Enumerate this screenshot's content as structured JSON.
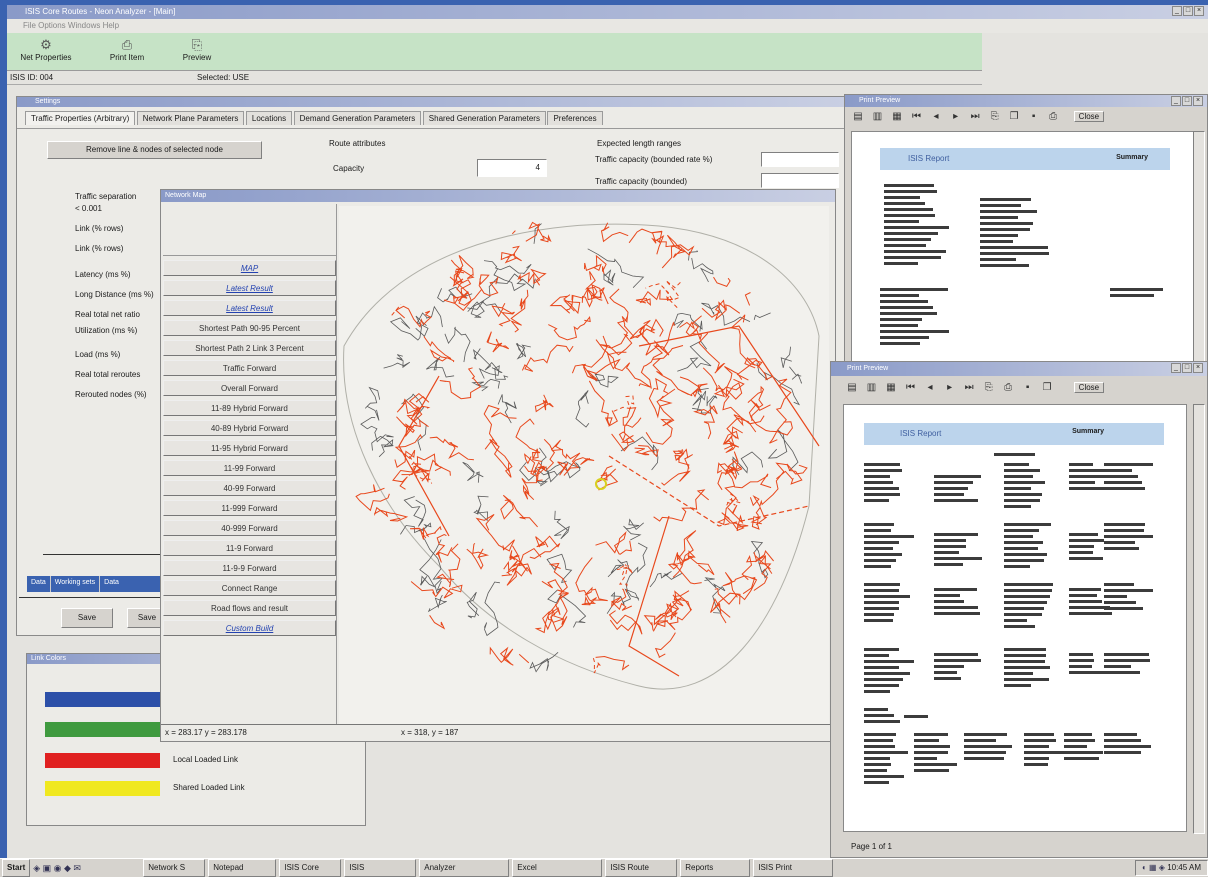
{
  "app": {
    "title": "ISIS Core Routes - Neon Analyzer - [Main]",
    "menu": "File   Options   Windows   Help",
    "toolbar": [
      {
        "label": "Net Properties",
        "icon": "gear-icon"
      },
      {
        "label": "Print Item",
        "icon": "printer-icon"
      },
      {
        "label": "Preview",
        "icon": "preview-icon"
      }
    ],
    "status_left": "ISIS ID: 004",
    "status_mid": "Selected:   USE"
  },
  "main_window": {
    "title": "Settings",
    "tabs": [
      "Traffic Properties (Arbitrary)",
      "Network Plane Parameters",
      "Locations",
      "Demand Generation Parameters",
      "Shared Generation Parameters",
      "Preferences"
    ],
    "options_button": "Remove line & nodes of selected node",
    "route_group_label": "Route attributes",
    "route_field_label": "Capacity",
    "route_field_value": "4",
    "fields_header": "Expected length ranges",
    "field1_label": "Traffic capacity (bounded rate %)",
    "field2_label": "Traffic capacity (bounded)",
    "left_labels": [
      "Traffic separation",
      "< 0.001",
      "Link (% rows)",
      "Link (% rows)",
      "Latency (ms %)",
      "Long Distance (ms %)",
      "Real total net ratio",
      "Utilization (ms %)",
      "Load (ms %)",
      "Real total reroutes",
      "Rerouted nodes (%)"
    ],
    "bottom_tabs": [
      "Data",
      "Working sets",
      "Data"
    ],
    "save_button": "Save",
    "cancel_button": "Save"
  },
  "map_window": {
    "title": "Network Map",
    "legend_items": [
      {
        "label": "MAP",
        "link": true
      },
      {
        "label": "Latest Result",
        "link": true
      },
      {
        "label": "Latest Result",
        "link": true
      },
      {
        "label": "Shortest Path 90-95 Percent",
        "link": false
      },
      {
        "label": "Shortest Path 2 Link 3 Percent",
        "link": false
      },
      {
        "label": "Traffic Forward",
        "link": false
      },
      {
        "label": "Overall Forward",
        "link": false
      },
      {
        "label": "11-89 Hybrid Forward",
        "link": false
      },
      {
        "label": "40-89 Hybrid Forward",
        "link": false
      },
      {
        "label": "11-95 Hybrid Forward",
        "link": false
      },
      {
        "label": "11-99 Forward",
        "link": false
      },
      {
        "label": "40-99 Forward",
        "link": false
      },
      {
        "label": "11-999 Forward",
        "link": false
      },
      {
        "label": "40-999 Forward",
        "link": false
      },
      {
        "label": "11-9 Forward",
        "link": false
      },
      {
        "label": "11-9-9 Forward",
        "link": false
      },
      {
        "label": "Connect Range",
        "link": false
      },
      {
        "label": "Road flows and result",
        "link": false
      },
      {
        "label": "Custom Build",
        "link": true
      }
    ],
    "coord_left": "x = 283.17   y = 283.178",
    "coord_right": "x = 318, y = 187",
    "colors": {
      "primary_route": "#e8481c",
      "secondary_route": "#5a5a5a",
      "highlight": "#d8d020"
    }
  },
  "color_legend": {
    "title": "Link Colors",
    "items": [
      {
        "color": "#2c4fa8",
        "label": ""
      },
      {
        "color": "#3f9a3f",
        "label": ""
      },
      {
        "color": "#e02020",
        "label": "Local Loaded Link"
      },
      {
        "color": "#f0e820",
        "label": "Shared Loaded Link"
      }
    ]
  },
  "print_preview_back": {
    "title": "Print Preview",
    "close_button": "Close",
    "report_title": "ISIS Report",
    "report_subtitle": "Summary"
  },
  "print_preview_front": {
    "title": "Print Preview",
    "close_button": "Close",
    "report_title": "ISIS Report",
    "report_subtitle": "Summary",
    "status": "Page 1 of 1"
  },
  "taskbar": {
    "start_label": "Start",
    "tasks": [
      "Network S",
      "Notepad",
      "ISIS Core",
      "ISIS",
      "Analyzer",
      "Excel",
      "ISIS Route",
      "Reports",
      "ISIS Print"
    ],
    "clock": "10:45 AM"
  }
}
